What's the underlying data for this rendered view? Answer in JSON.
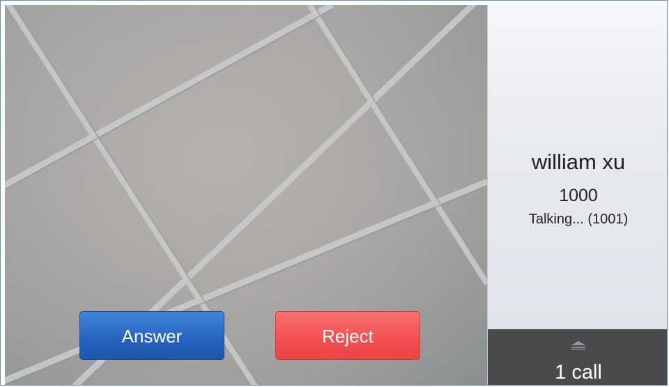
{
  "call": {
    "caller_name": "william xu",
    "caller_number": "1000",
    "status": "Talking... (1001)"
  },
  "actions": {
    "answer_label": "Answer",
    "reject_label": "Reject"
  },
  "calls_tab": {
    "count_label": "1 call",
    "icon": "chevron-up-icon"
  },
  "colors": {
    "answer": "#2563c0",
    "reject": "#f24f51",
    "calls_tab": "#4a4a4d"
  }
}
